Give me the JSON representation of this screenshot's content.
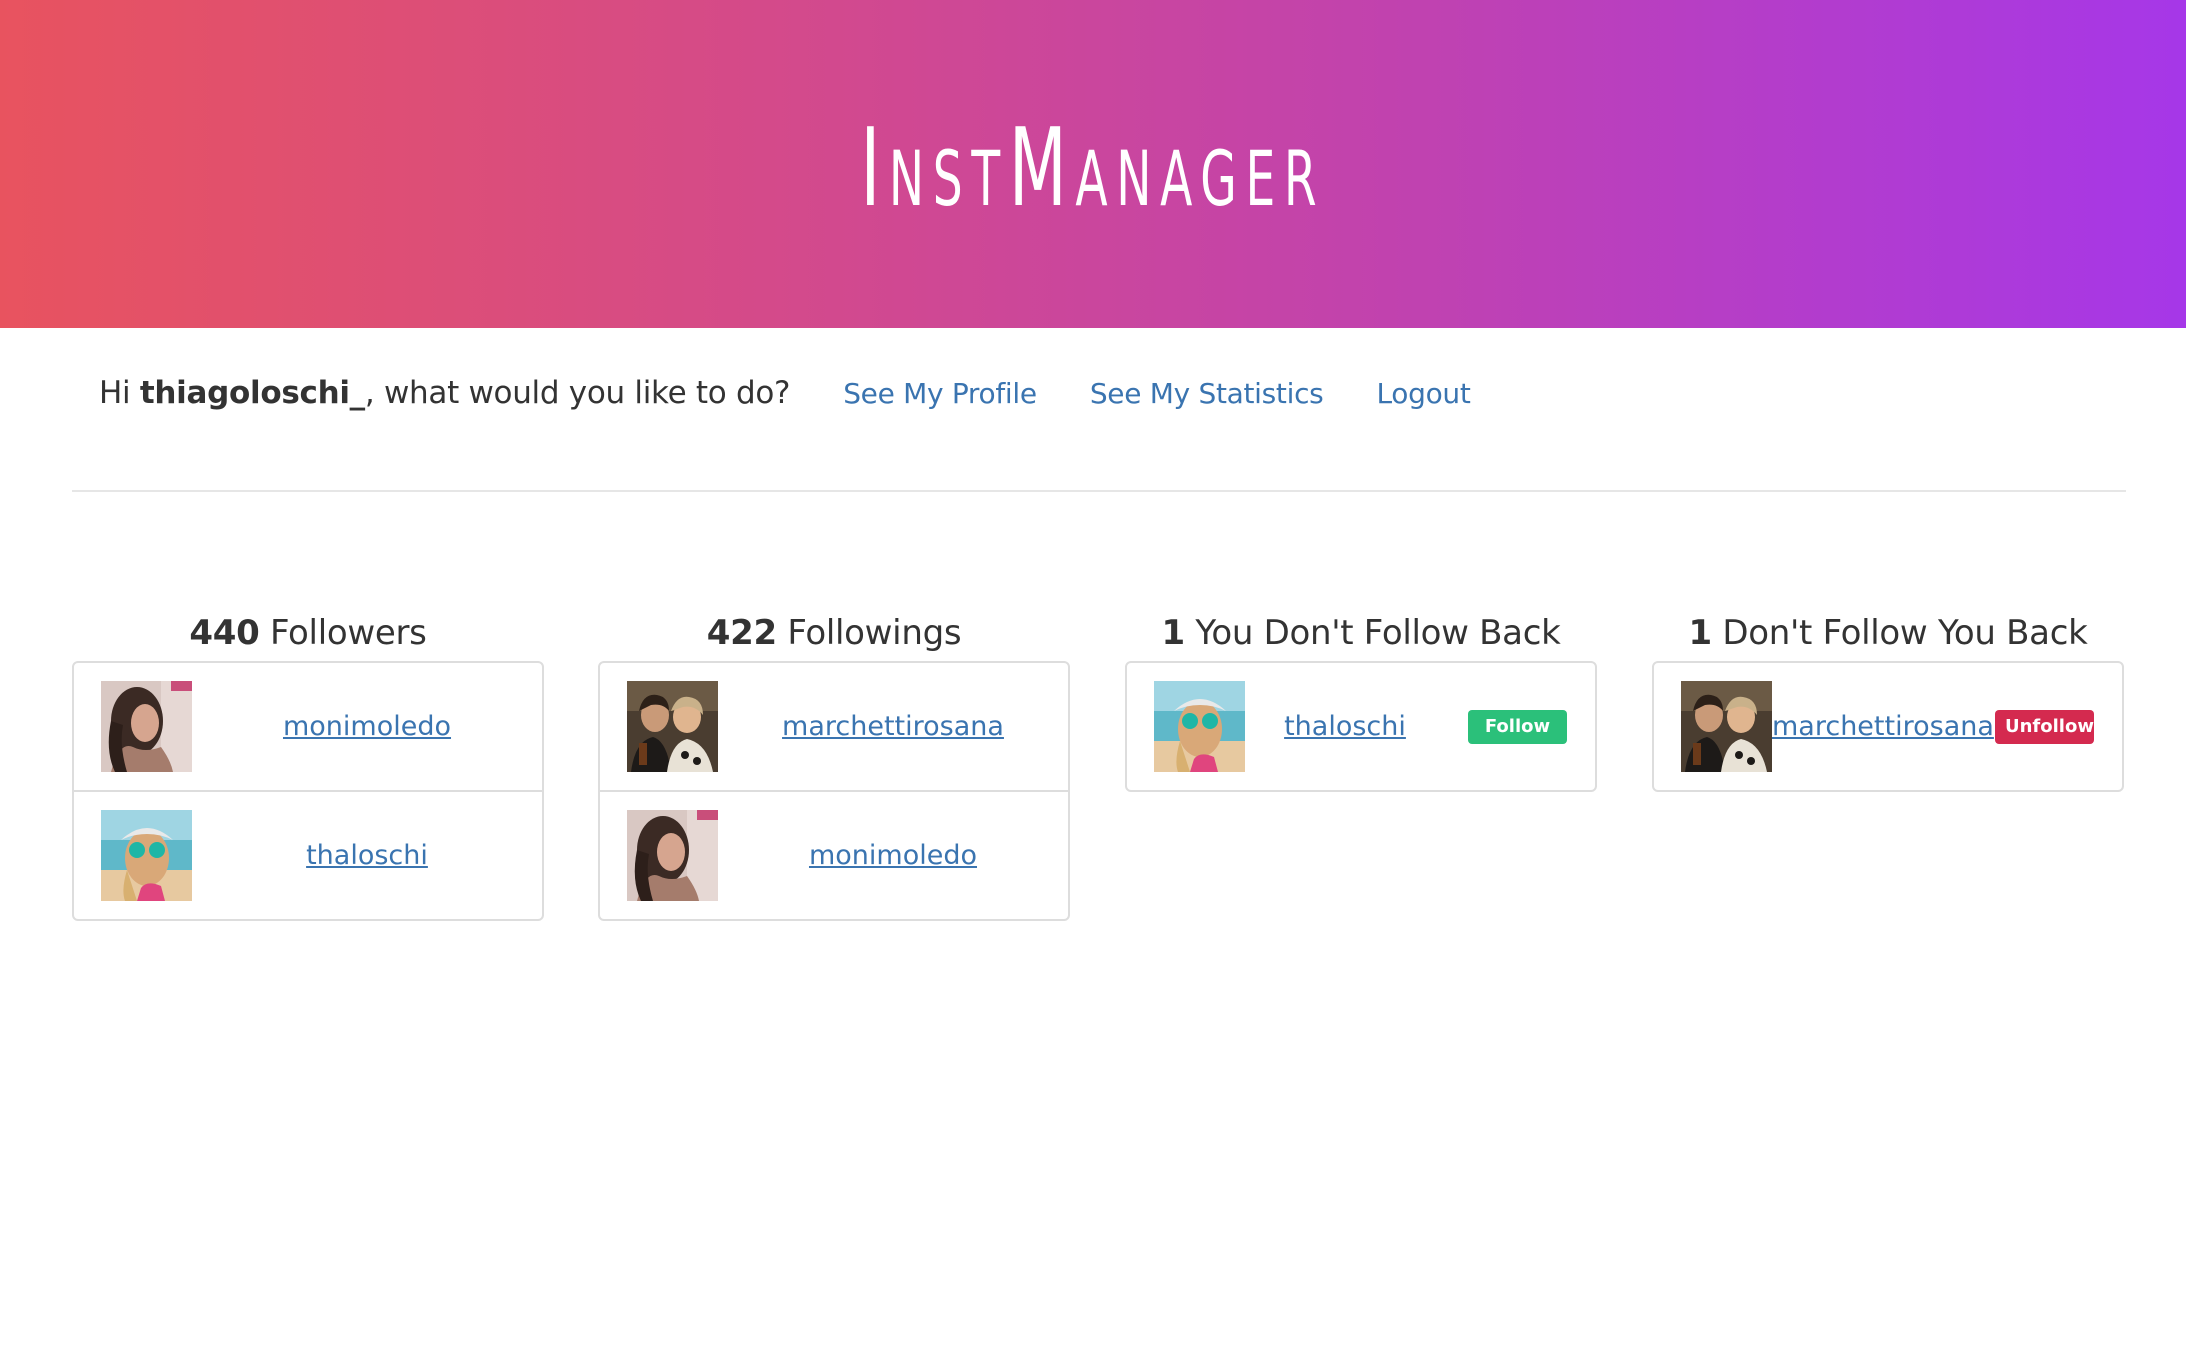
{
  "header": {
    "logo": "InstManager",
    "colors": [
      "#e8535f",
      "#a637e8"
    ]
  },
  "nav": {
    "greeting_prefix": "Hi ",
    "username": "thiagoloschi_",
    "greeting_suffix": ", what would you like to do?",
    "links": {
      "profile": "See My Profile",
      "statistics": "See My Statistics",
      "logout": "Logout"
    }
  },
  "columns": [
    {
      "count": "440",
      "label": " Followers",
      "users": [
        {
          "name": "monimoledo",
          "avatar": "avatar-dark-hair"
        },
        {
          "name": "thaloschi",
          "avatar": "avatar-beach-sunglasses"
        }
      ]
    },
    {
      "count": "422",
      "label": " Followings",
      "users": [
        {
          "name": "marchettirosana",
          "avatar": "avatar-couple"
        },
        {
          "name": "monimoledo",
          "avatar": "avatar-dark-hair"
        }
      ]
    },
    {
      "count": "1",
      "label": " You Don't Follow Back",
      "users": [
        {
          "name": "thaloschi",
          "avatar": "avatar-beach-sunglasses",
          "action": "Follow"
        }
      ]
    },
    {
      "count": "1",
      "label": " Don't Follow You Back",
      "users": [
        {
          "name": "marchettirosana",
          "avatar": "avatar-couple",
          "action": "Unfollow"
        }
      ]
    }
  ],
  "colors": {
    "link": "#3a74b0",
    "follow": "#2bc07a",
    "unfollow": "#d42a4f"
  }
}
